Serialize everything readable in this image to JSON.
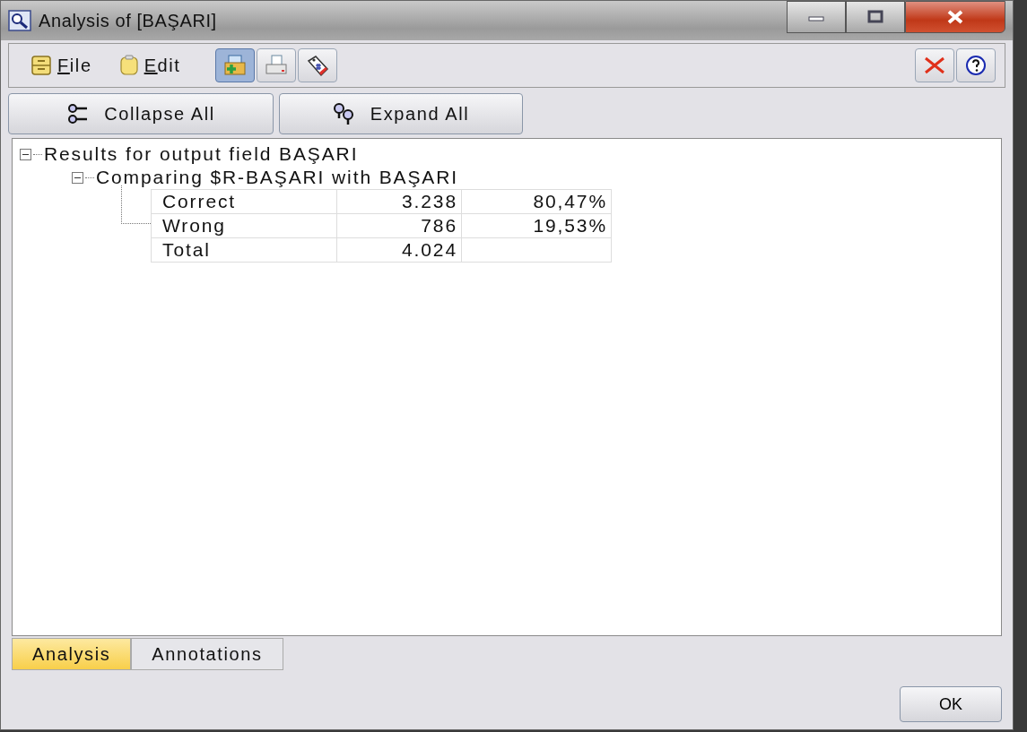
{
  "window": {
    "title": "Analysis of [BAŞARI]"
  },
  "menu": [
    {
      "label": "File",
      "kind": "file"
    },
    {
      "label": "Edit",
      "kind": "edit"
    }
  ],
  "toolbar_icons": [
    {
      "kind": "add",
      "selected": true
    },
    {
      "kind": "print",
      "selected": false
    },
    {
      "kind": "tag",
      "selected": false
    }
  ],
  "buttons": [
    {
      "label": "Collapse All",
      "kind": "collapse"
    },
    {
      "label": "Expand All",
      "kind": "expand"
    }
  ],
  "tree": [
    {
      "label": "Results for output field BAŞARI",
      "expanded": true,
      "children": [
        {
          "label": "Comparing $R-BAŞARI with BAŞARI",
          "expanded": true,
          "table": [
            [
              "Correct",
              "3.238",
              "80,47%"
            ],
            [
              "Wrong",
              "786",
              "19,53%"
            ],
            [
              "Total",
              "4.024"
            ]
          ]
        }
      ]
    }
  ],
  "tabs": [
    {
      "label": "Analysis",
      "selected": true
    },
    {
      "label": "Annotations",
      "selected": false
    }
  ],
  "ok_button": "OK"
}
